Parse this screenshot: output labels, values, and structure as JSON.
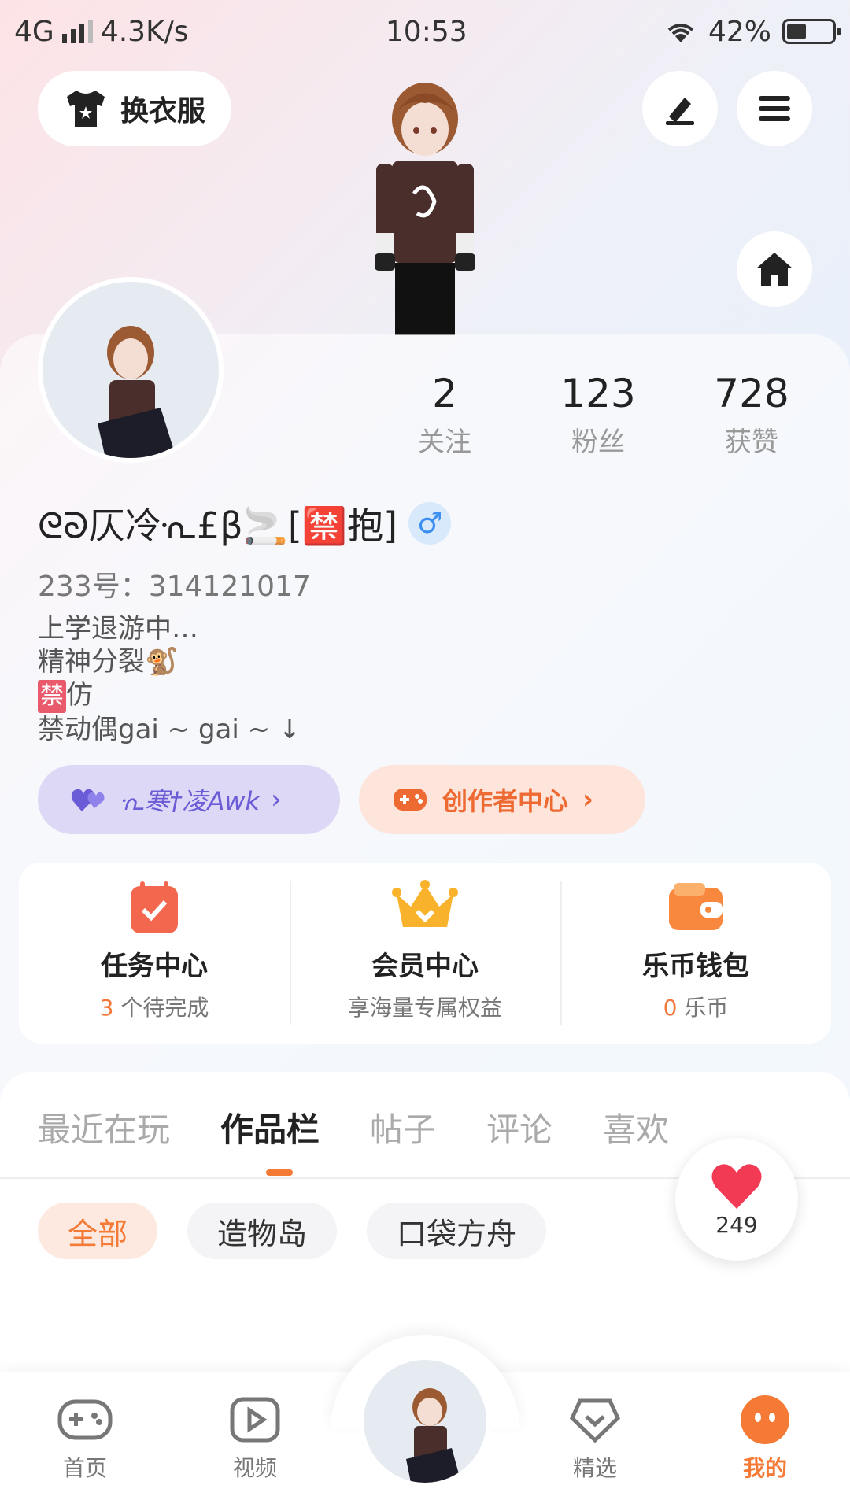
{
  "status_bar": {
    "network": "4G",
    "speed": "4.3K/s",
    "time": "10:53",
    "battery": "42%",
    "battery_level": 0.42
  },
  "header": {
    "outfit_button": "换衣服",
    "edit_icon": "edit-icon",
    "menu_icon": "menu-icon",
    "home_icon": "home-icon"
  },
  "profile": {
    "nickname": "ᘓᘐ仄冷ᣏ£β🚬[🈲抱]",
    "gender_symbol": "♂",
    "uid": "233号：314121017",
    "bio": [
      "上学退游中…",
      "精神分裂🐒",
      "仿",
      "禁动偶gai ~ gai ~ ↓"
    ],
    "bio_ban_tag": "禁",
    "stats": [
      {
        "value": "2",
        "label": "关注"
      },
      {
        "value": "123",
        "label": "粉丝"
      },
      {
        "value": "728",
        "label": "获赞"
      }
    ],
    "tag_purple": "ᣏ寒†凌Awk",
    "tag_creator": "创作者中心"
  },
  "services": [
    {
      "title": "任务中心",
      "sub_highlight": "3",
      "sub_text": " 个待完成",
      "icon": "calendar-check-icon"
    },
    {
      "title": "会员中心",
      "sub_highlight": "",
      "sub_text": "享海量专属权益",
      "icon": "crown-icon"
    },
    {
      "title": "乐币钱包",
      "sub_highlight": "0",
      "sub_text": " 乐币",
      "icon": "wallet-icon"
    }
  ],
  "tabs": [
    "最近在玩",
    "作品栏",
    "帖子",
    "评论",
    "喜欢"
  ],
  "active_tab": "作品栏",
  "chips": [
    "全部",
    "造物岛",
    "口袋方舟"
  ],
  "like_count": "249",
  "bottom_nav": [
    {
      "label": "首页",
      "icon": "gamepad-icon"
    },
    {
      "label": "视频",
      "icon": "video-play-icon"
    },
    {
      "label": "精选",
      "icon": "heart-diamond-icon"
    },
    {
      "label": "我的",
      "icon": "face-icon"
    }
  ],
  "colors": {
    "accent": "#f47a35",
    "purple": "#6a5bd6",
    "gender_blue": "#3c8ef0"
  }
}
